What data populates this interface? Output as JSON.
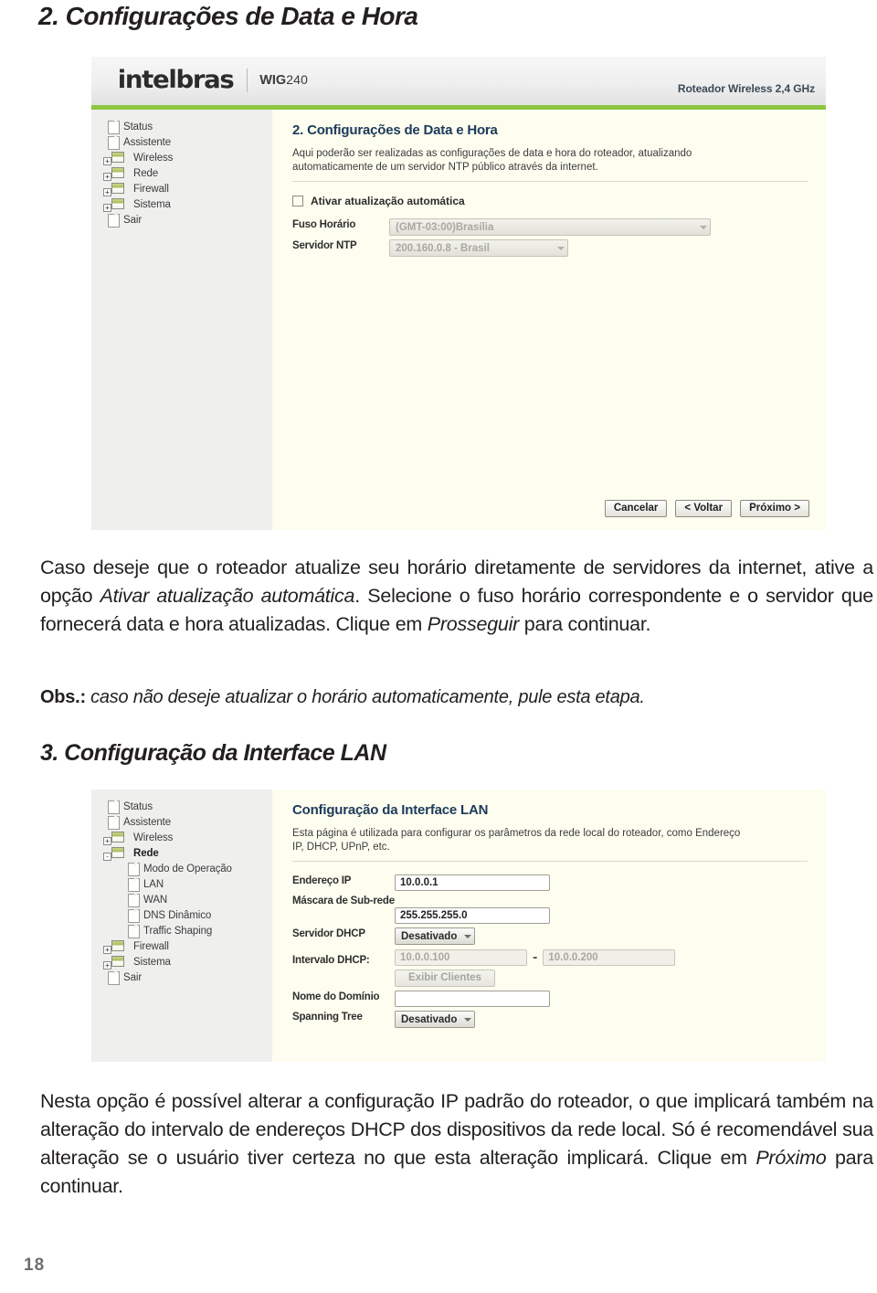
{
  "page": {
    "number": "18",
    "heading_2": "2. Configurações de Data e Hora",
    "heading_3": "3. Configuração da Interface LAN"
  },
  "router_ui": {
    "brand": "intelbras",
    "model_prefix": "WIG",
    "model_number": "240",
    "header_right": "Roteador Wireless 2,4 GHz",
    "accent_green": "#8dc63f",
    "sidebar_bg": "#efefee",
    "panel_bg": "#fdfdf0"
  },
  "screen_datetime": {
    "sidebar": [
      {
        "label": "Status",
        "icon": "document-icon",
        "type": "leaf"
      },
      {
        "label": "Assistente",
        "icon": "document-icon",
        "type": "leaf"
      },
      {
        "label": "Wireless",
        "icon": "folder-icon",
        "type": "folder",
        "expander": "+"
      },
      {
        "label": "Rede",
        "icon": "folder-icon",
        "type": "folder",
        "expander": "+"
      },
      {
        "label": "Firewall",
        "icon": "folder-icon",
        "type": "folder",
        "expander": "+"
      },
      {
        "label": "Sistema",
        "icon": "folder-icon",
        "type": "folder",
        "expander": "+"
      },
      {
        "label": "Sair",
        "icon": "document-icon",
        "type": "leaf"
      }
    ],
    "title": "2. Configurações de Data e Hora",
    "description": "Aqui poderão ser realizadas as configurações de data e hora do roteador, atualizando automaticamente de um servidor NTP público através da internet.",
    "checkbox_label": "Ativar atualização automática",
    "checkbox_checked": false,
    "fields": [
      {
        "label": "Fuso Horário",
        "value": "(GMT-03:00)Brasília",
        "control": "select",
        "disabled": true
      },
      {
        "label": "Servidor NTP",
        "value": "200.160.0.8 - Brasil",
        "control": "select",
        "disabled": true
      }
    ],
    "buttons": [
      {
        "label": "Cancelar"
      },
      {
        "label": "< Voltar"
      },
      {
        "label": "Próximo >"
      }
    ]
  },
  "screen_lan": {
    "sidebar": [
      {
        "label": "Status",
        "icon": "document-icon",
        "type": "leaf"
      },
      {
        "label": "Assistente",
        "icon": "document-icon",
        "type": "leaf"
      },
      {
        "label": "Wireless",
        "icon": "folder-icon",
        "type": "folder",
        "expander": "+"
      },
      {
        "label": "Rede",
        "icon": "folder-icon",
        "type": "folder",
        "expander": "-",
        "bold": true
      },
      {
        "label": "Modo de Operação",
        "icon": "document-icon",
        "type": "child"
      },
      {
        "label": "LAN",
        "icon": "document-icon",
        "type": "child"
      },
      {
        "label": "WAN",
        "icon": "document-icon",
        "type": "child"
      },
      {
        "label": "DNS Dinâmico",
        "icon": "document-icon",
        "type": "child"
      },
      {
        "label": "Traffic Shaping",
        "icon": "document-icon",
        "type": "child"
      },
      {
        "label": "Firewall",
        "icon": "folder-icon",
        "type": "folder",
        "expander": "+"
      },
      {
        "label": "Sistema",
        "icon": "folder-icon",
        "type": "folder",
        "expander": "+"
      },
      {
        "label": "Sair",
        "icon": "document-icon",
        "type": "leaf"
      }
    ],
    "title": "Configuração da Interface LAN",
    "description": "Esta página é utilizada para configurar os parâmetros da rede local do roteador, como Endereço IP, DHCP, UPnP, etc.",
    "labels": {
      "ip": "Endereço IP",
      "mask": "Máscara de Sub-rede",
      "dhcp_server": "Servidor DHCP",
      "dhcp_range": "Intervalo DHCP:",
      "domain": "Nome do Domínio",
      "spanning_tree": "Spanning Tree"
    },
    "values": {
      "ip": "10.0.0.1",
      "mask": "255.255.255.0",
      "dhcp_server": "Desativado",
      "dhcp_range_start": "10.0.0.100",
      "dhcp_range_end": "10.0.0.200",
      "dhcp_range_separator": "-",
      "show_clients_button": "Exibir Clientes",
      "domain": "",
      "spanning_tree": "Desativado"
    }
  },
  "body_text": {
    "paragraph_1_a": "Caso deseje que o roteador atualize seu horário diretamente de servidores da internet, ative a opção ",
    "paragraph_1_em1": "Ativar atualização automática",
    "paragraph_1_b": ". Selecione o fuso horário correspondente e o servidor que fornecerá data e hora atualizadas. Clique em ",
    "paragraph_1_em2": "Prosseguir",
    "paragraph_1_c": " para continuar.",
    "obs_label": "Obs.:",
    "obs_text": " caso não deseje atualizar o horário automaticamente, pule esta etapa.",
    "paragraph_2_a": "Nesta opção é possível alterar a configuração IP padrão do roteador, o que implicará também na alteração do intervalo de endereços DHCP dos dispositivos da rede local. Só é recomendável sua alteração se o usuário tiver certeza no que esta alteração implicará. Clique em ",
    "paragraph_2_em": "Próximo",
    "paragraph_2_b": " para continuar."
  }
}
